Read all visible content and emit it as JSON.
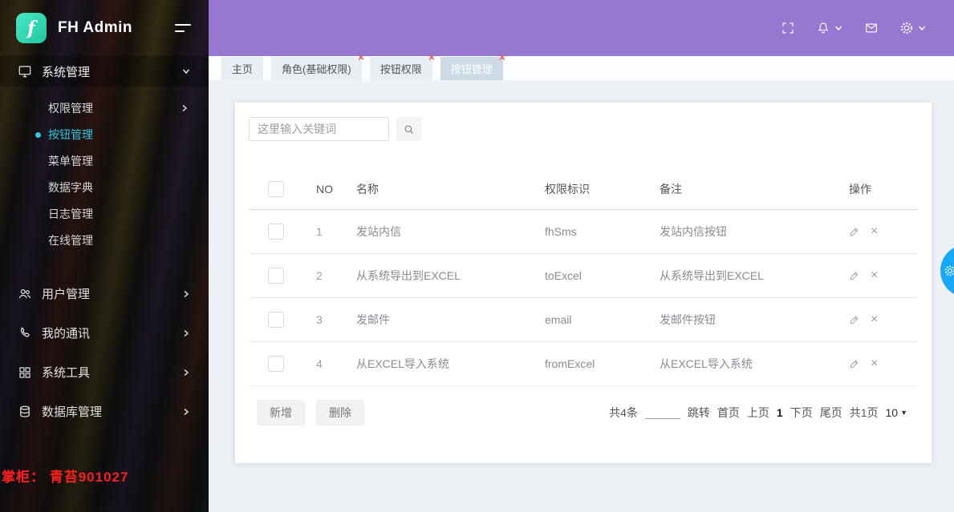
{
  "app": {
    "title": "FH Admin",
    "logo_letter": "f"
  },
  "colors": {
    "header_purple": "#9678d0",
    "logo_teal": "#2bd9ae",
    "sidebar_active_cyan": "#30c9e0",
    "handle_blue": "#18a8f5",
    "close_red": "#e05c5c",
    "footer_red": "#fe1e1e"
  },
  "header": {
    "icons": [
      "fullscreen-icon",
      "bell-icon",
      "mail-icon",
      "gear-icon"
    ]
  },
  "sidebar": {
    "section": {
      "label": "系统管理",
      "icon": "monitor-icon"
    },
    "submenu": [
      {
        "label": "权限管理"
      },
      {
        "label": "按钮管理"
      },
      {
        "label": "菜单管理"
      },
      {
        "label": "数据字典"
      },
      {
        "label": "日志管理"
      },
      {
        "label": "在线管理"
      }
    ],
    "groups": [
      {
        "label": "用户管理",
        "icon": "users-icon"
      },
      {
        "label": "我的通讯",
        "icon": "phone-icon"
      },
      {
        "label": "系统工具",
        "icon": "grid-icon"
      },
      {
        "label": "数据库管理",
        "icon": "database-icon"
      }
    ],
    "footer": "掌柜： 青苔901027"
  },
  "tabs": [
    {
      "label": "主页"
    },
    {
      "label": "角色(基础权限)"
    },
    {
      "label": "按钮权限"
    },
    {
      "label": "按钮管理"
    }
  ],
  "search": {
    "placeholder": "这里输入关键词"
  },
  "table": {
    "headers": {
      "no": "NO",
      "name": "名称",
      "perm": "权限标识",
      "note": "备注",
      "ops": "操作"
    },
    "rows": [
      {
        "no": "1",
        "name": "发站内信",
        "perm": "fhSms",
        "note": "发站内信按钮"
      },
      {
        "no": "2",
        "name": "从系统导出到EXCEL",
        "perm": "toExcel",
        "note": "从系统导出到EXCEL"
      },
      {
        "no": "3",
        "name": "发邮件",
        "perm": "email",
        "note": "发邮件按钮"
      },
      {
        "no": "4",
        "name": "从EXCEL导入系统",
        "perm": "fromExcel",
        "note": "从EXCEL导入系统"
      }
    ]
  },
  "actions": {
    "add": "新增",
    "delete": "删除"
  },
  "pagination": {
    "total": "共4条",
    "jump": "跳转",
    "first": "首页",
    "prev": "上页",
    "current": "1",
    "next": "下页",
    "last": "尾页",
    "pages": "共1页",
    "page_size": "10"
  }
}
